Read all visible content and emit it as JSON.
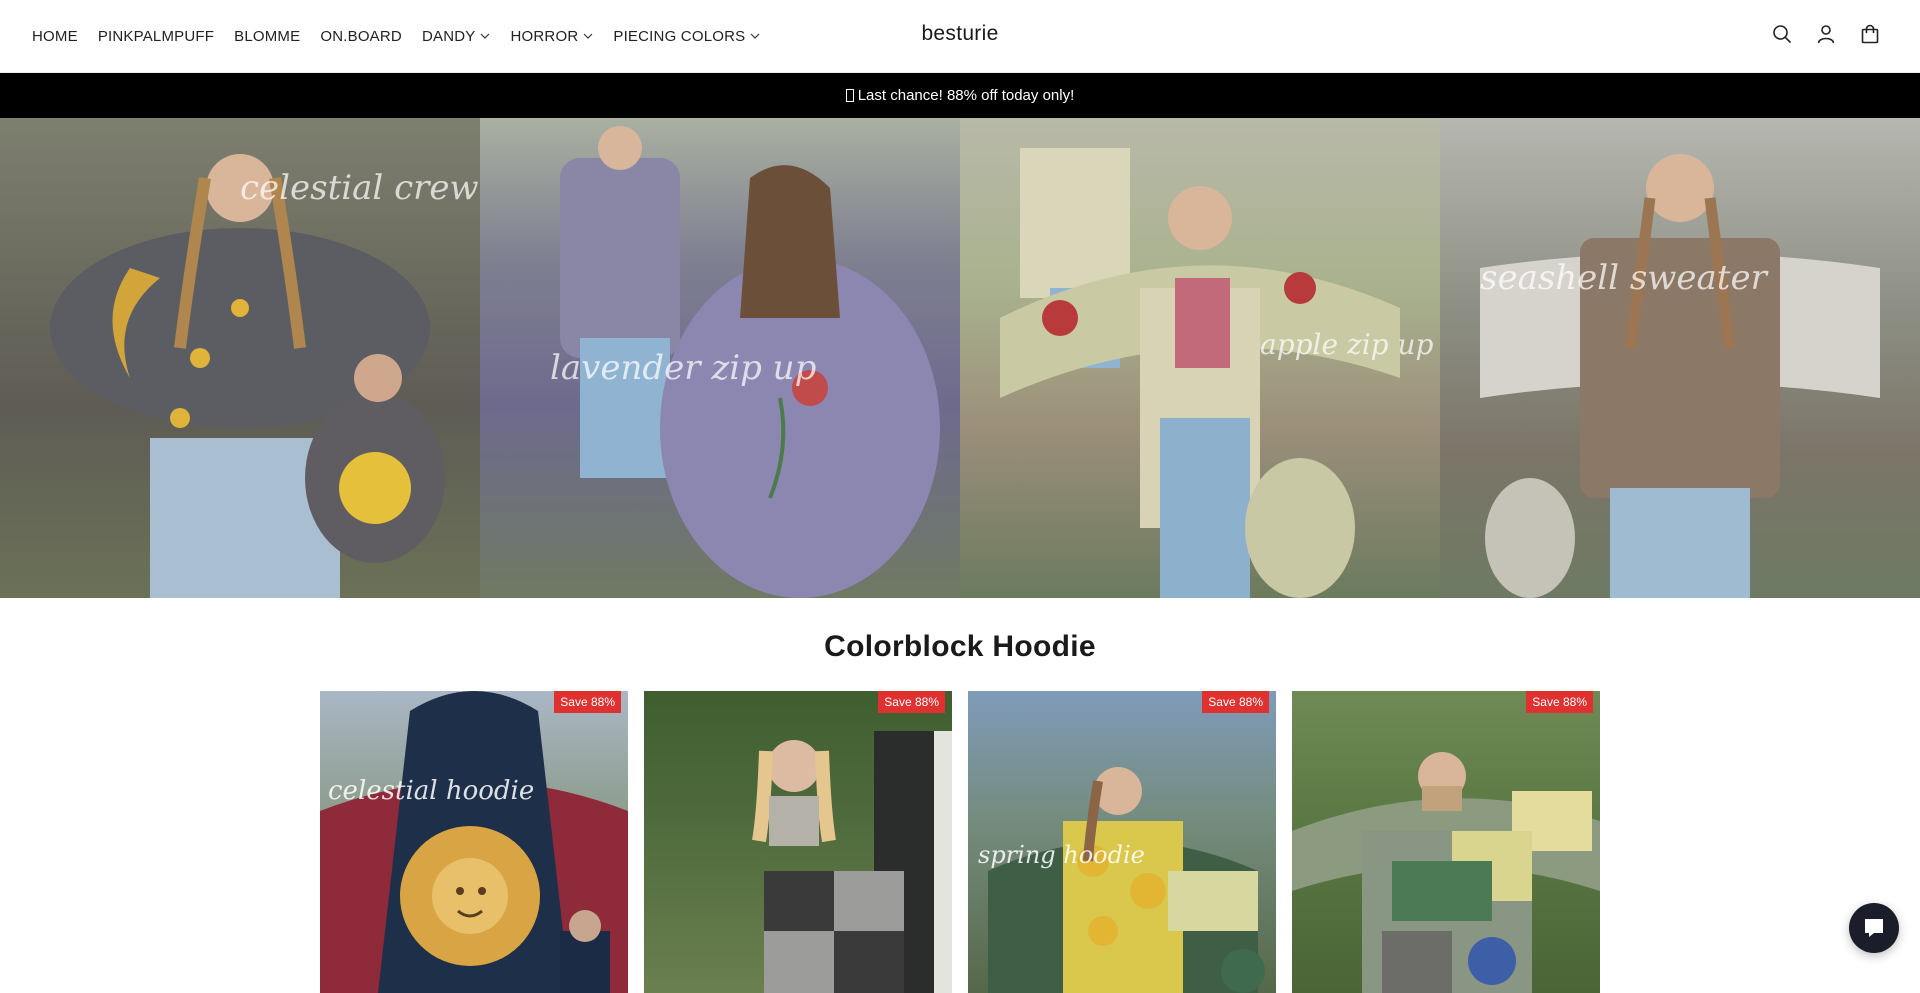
{
  "brand": {
    "name": "besturie"
  },
  "nav": {
    "items": [
      {
        "label": "HOME",
        "has_dropdown": false
      },
      {
        "label": "PINKPALMPUFF",
        "has_dropdown": false
      },
      {
        "label": "BLOMME",
        "has_dropdown": false
      },
      {
        "label": "ON.BOARD",
        "has_dropdown": false
      },
      {
        "label": "DANDY",
        "has_dropdown": true
      },
      {
        "label": "HORROR",
        "has_dropdown": true
      },
      {
        "label": "PIECING COLORS",
        "has_dropdown": true
      }
    ]
  },
  "header_icons": [
    "search-icon",
    "account-icon",
    "cart-icon"
  ],
  "announcement": {
    "text": "Last chance! 88% off today only!",
    "glyph": "missing-glyph"
  },
  "hero": {
    "panels": [
      {
        "script": "celestial crew"
      },
      {
        "script": "lavender zip up"
      },
      {
        "script": "apple zip up"
      },
      {
        "script": "seashell sweater"
      }
    ]
  },
  "collection": {
    "title": "Colorblock Hoodie",
    "products": [
      {
        "badge": "Save 88%",
        "script": "celestial hoodie"
      },
      {
        "badge": "Save 88%",
        "script": ""
      },
      {
        "badge": "Save 88%",
        "script": "spring hoodie"
      },
      {
        "badge": "Save 88%",
        "script": ""
      }
    ]
  },
  "colors": {
    "badge": "#e03131",
    "announcement_bg": "#000000",
    "chat_bg": "#1c1d2b"
  },
  "chat": {
    "icon": "chat-bubble-icon"
  }
}
